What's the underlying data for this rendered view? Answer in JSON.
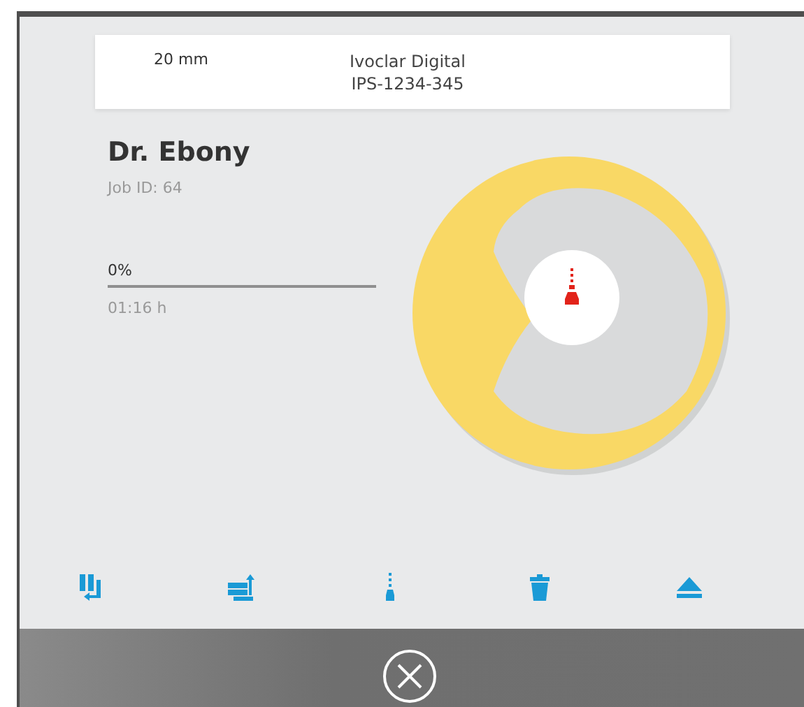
{
  "header": {
    "size": "20 mm",
    "manufacturer": "Ivoclar Digital",
    "serial": "IPS-1234-345"
  },
  "job": {
    "name": "Dr. Ebony",
    "job_id": "Job ID: 64",
    "progress": {
      "label": "0%",
      "level": 0
    },
    "time": "01:16 h"
  },
  "toolbar": [
    {
      "kind": "move-down"
    },
    {
      "kind": "swap"
    },
    {
      "kind": "mill"
    },
    {
      "kind": "delete"
    },
    {
      "kind": "eject"
    }
  ]
}
